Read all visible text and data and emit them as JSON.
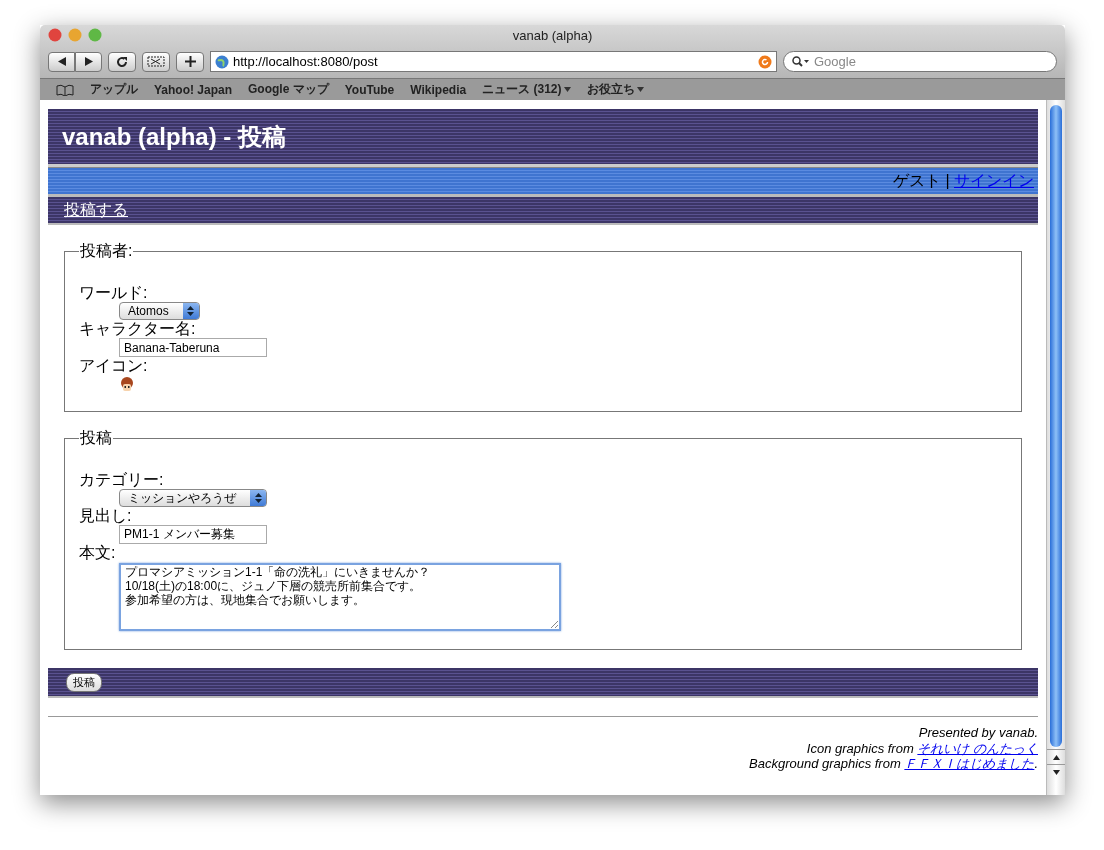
{
  "window": {
    "title": "vanab (alpha)"
  },
  "toolbar": {
    "url": "http://localhost:8080/post",
    "search_placeholder": "Google"
  },
  "bookmarks": [
    {
      "label": "アップル",
      "kind": "link"
    },
    {
      "label": "Yahoo! Japan",
      "kind": "link"
    },
    {
      "label": "Google マップ",
      "kind": "link"
    },
    {
      "label": "YouTube",
      "kind": "link"
    },
    {
      "label": "Wikipedia",
      "kind": "link"
    },
    {
      "label": "ニュース (312)",
      "kind": "menu"
    },
    {
      "label": "お役立ち",
      "kind": "menu"
    }
  ],
  "header": {
    "title": "vanab (alpha) - 投稿"
  },
  "userbar": {
    "guest": "ゲスト",
    "separator": "|",
    "signin_link": "サインイン"
  },
  "nav": {
    "link": "投稿する"
  },
  "sections": [
    {
      "legend": "投稿者:",
      "fields": [
        {
          "kind": "select",
          "label": "ワールド:",
          "value": "Atomos"
        },
        {
          "kind": "text",
          "label": "キャラクター名:",
          "value": "Banana-Taberuna"
        },
        {
          "kind": "icon",
          "label": "アイコン:"
        }
      ]
    },
    {
      "legend": "投稿",
      "fields": [
        {
          "kind": "select",
          "label": "カテゴリー:",
          "value": "ミッションやろうぜ"
        },
        {
          "kind": "text",
          "label": "見出し:",
          "value": "PM1-1 メンバー募集"
        },
        {
          "kind": "textarea",
          "label": "本文:",
          "lines": [
            "プロマシアミッション1-1「命の洗礼」にいきませんか？",
            "10/18(土)の18:00に、ジュノ下層の競売所前集合です。",
            "参加希望の方は、現地集合でお願いします。"
          ]
        }
      ]
    }
  ],
  "submit_button": "投稿",
  "footer": {
    "presented": "Presented by vanab.",
    "icon_credit": "Icon graphics from ",
    "icon_link": "それいけ のんたっく",
    "bg_credit": "Background graphics from ",
    "bg_link": "ＦＦＸＩはじめました",
    "bg_end": "."
  }
}
